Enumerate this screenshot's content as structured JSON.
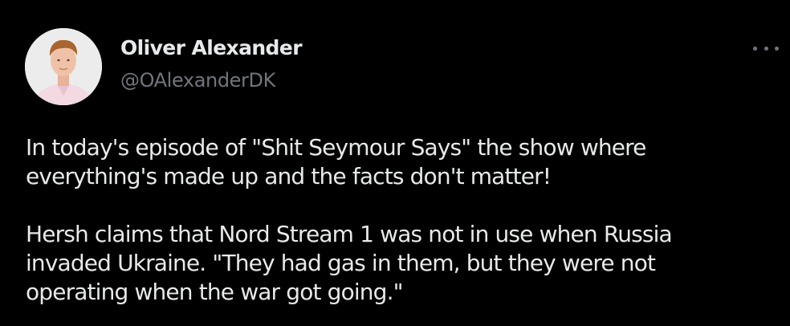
{
  "tweet": {
    "author": {
      "display_name": "Oliver Alexander",
      "handle": "@OAlexanderDK",
      "avatar_icon": "user-photo-avatar"
    },
    "more_icon": "ellipsis-icon",
    "body": {
      "paragraph_1": {
        "line_1": "In today's episode of \"Shit Seymour Says\" the show where",
        "line_2": "everything's made up and the facts don't matter!"
      },
      "paragraph_2": {
        "line_1": "Hersh claims that Nord Stream 1 was not in use when Russia",
        "line_2": "invaded Ukraine. \"They had gas in them, but they were not",
        "line_3": "operating when the war got going.\""
      }
    }
  },
  "colors": {
    "background": "#000000",
    "primary_text": "#e7e9ea",
    "secondary_text": "#71767b"
  }
}
